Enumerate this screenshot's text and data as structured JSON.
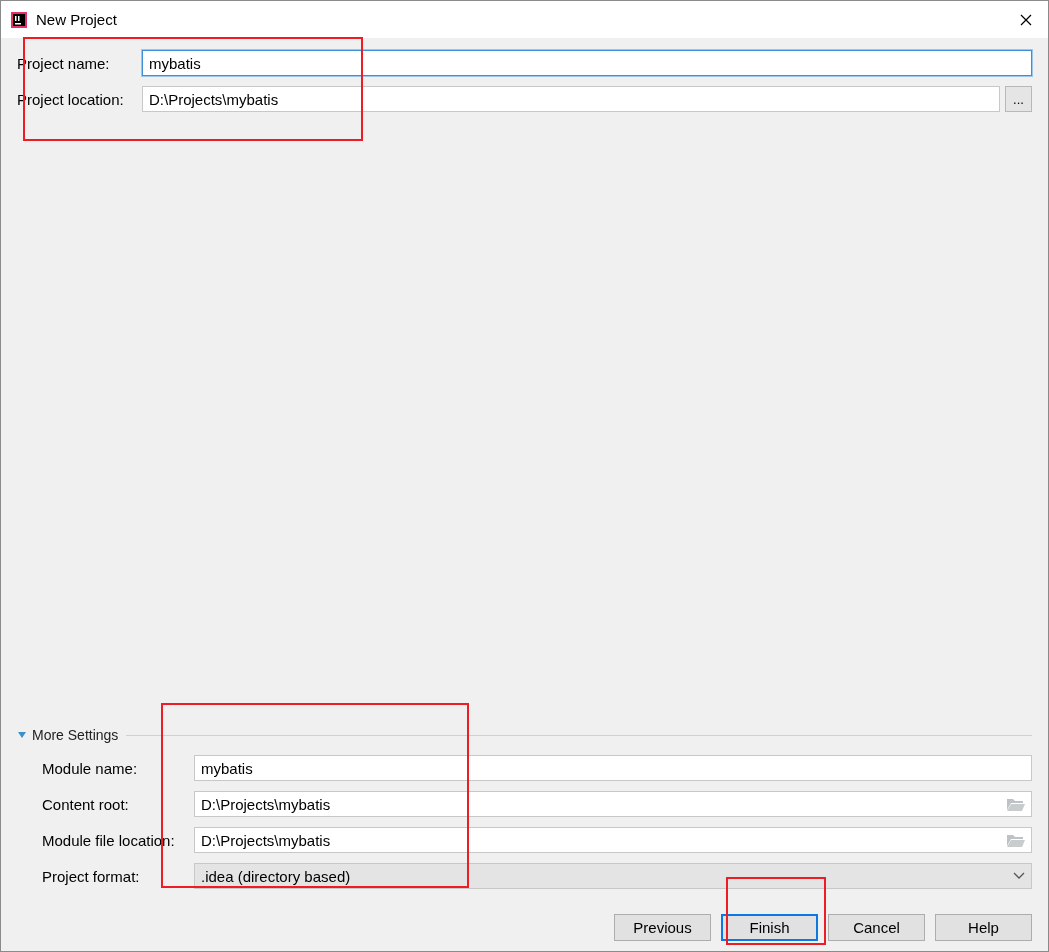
{
  "window": {
    "title": "New Project"
  },
  "project_fields": [
    {
      "label": "Project name:",
      "value": "mybatis",
      "focused": true,
      "kind": "text"
    },
    {
      "label": "Project location:",
      "value": "D:\\Projects\\mybatis",
      "focused": false,
      "kind": "browse",
      "button": "..."
    }
  ],
  "more_settings": {
    "label": "More Settings",
    "expanded": true,
    "fields": [
      {
        "label": "Module name:",
        "value": "mybatis",
        "kind": "text"
      },
      {
        "label": "Content root:",
        "value": "D:\\Projects\\mybatis",
        "kind": "folder"
      },
      {
        "label": "Module file location:",
        "value": "D:\\Projects\\mybatis",
        "kind": "folder"
      },
      {
        "label": "Project format:",
        "value": ".idea (directory based)",
        "kind": "dropdown"
      }
    ]
  },
  "buttons": [
    {
      "label": "Previous",
      "default": false
    },
    {
      "label": "Finish",
      "default": true
    },
    {
      "label": "Cancel",
      "default": false
    },
    {
      "label": "Help",
      "default": false
    }
  ]
}
